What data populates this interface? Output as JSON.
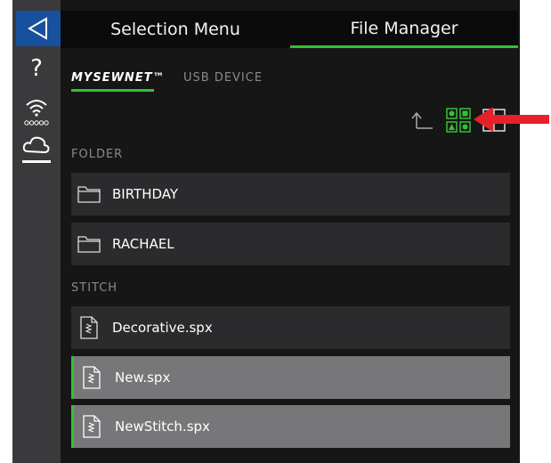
{
  "tabs": {
    "selection_menu": "Selection Menu",
    "file_manager": "File Manager"
  },
  "sources": {
    "mysewnet": "MYSEWNET™",
    "usb": "USB DEVICE"
  },
  "sections": {
    "folder": "FOLDER",
    "stitch": "STITCH"
  },
  "folders": [
    {
      "label": "BIRTHDAY"
    },
    {
      "label": "RACHAEL"
    }
  ],
  "stitches": [
    {
      "label": "Decorative.spx",
      "selected": false
    },
    {
      "label": "New.spx",
      "selected": true
    },
    {
      "label": "NewStitch.spx",
      "selected": true
    }
  ],
  "sidebar": {
    "icons": [
      "back-icon",
      "help-icon",
      "wifi-icon",
      "cloud-icon"
    ]
  },
  "toolbar": {
    "icons": [
      "up-folder-icon",
      "thumbnail-view-icon",
      "list-view-icon"
    ]
  },
  "colors": {
    "accent": "#33c233",
    "back_button": "#17509c",
    "annotation_arrow": "#e8202a"
  }
}
